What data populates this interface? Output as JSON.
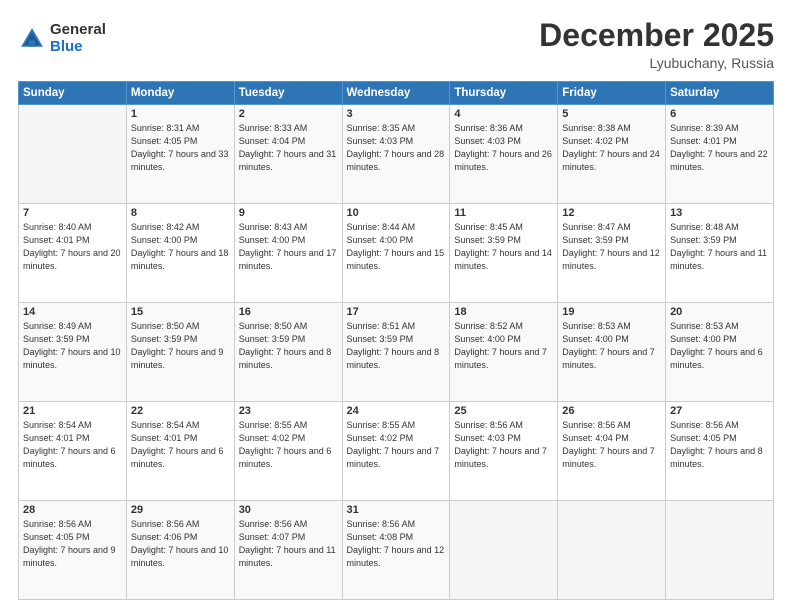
{
  "header": {
    "logo_general": "General",
    "logo_blue": "Blue",
    "month": "December 2025",
    "location": "Lyubuchany, Russia"
  },
  "days_of_week": [
    "Sunday",
    "Monday",
    "Tuesday",
    "Wednesday",
    "Thursday",
    "Friday",
    "Saturday"
  ],
  "weeks": [
    [
      {
        "num": "",
        "empty": true
      },
      {
        "num": "1",
        "sunrise": "Sunrise: 8:31 AM",
        "sunset": "Sunset: 4:05 PM",
        "daylight": "Daylight: 7 hours and 33 minutes."
      },
      {
        "num": "2",
        "sunrise": "Sunrise: 8:33 AM",
        "sunset": "Sunset: 4:04 PM",
        "daylight": "Daylight: 7 hours and 31 minutes."
      },
      {
        "num": "3",
        "sunrise": "Sunrise: 8:35 AM",
        "sunset": "Sunset: 4:03 PM",
        "daylight": "Daylight: 7 hours and 28 minutes."
      },
      {
        "num": "4",
        "sunrise": "Sunrise: 8:36 AM",
        "sunset": "Sunset: 4:03 PM",
        "daylight": "Daylight: 7 hours and 26 minutes."
      },
      {
        "num": "5",
        "sunrise": "Sunrise: 8:38 AM",
        "sunset": "Sunset: 4:02 PM",
        "daylight": "Daylight: 7 hours and 24 minutes."
      },
      {
        "num": "6",
        "sunrise": "Sunrise: 8:39 AM",
        "sunset": "Sunset: 4:01 PM",
        "daylight": "Daylight: 7 hours and 22 minutes."
      }
    ],
    [
      {
        "num": "7",
        "sunrise": "Sunrise: 8:40 AM",
        "sunset": "Sunset: 4:01 PM",
        "daylight": "Daylight: 7 hours and 20 minutes."
      },
      {
        "num": "8",
        "sunrise": "Sunrise: 8:42 AM",
        "sunset": "Sunset: 4:00 PM",
        "daylight": "Daylight: 7 hours and 18 minutes."
      },
      {
        "num": "9",
        "sunrise": "Sunrise: 8:43 AM",
        "sunset": "Sunset: 4:00 PM",
        "daylight": "Daylight: 7 hours and 17 minutes."
      },
      {
        "num": "10",
        "sunrise": "Sunrise: 8:44 AM",
        "sunset": "Sunset: 4:00 PM",
        "daylight": "Daylight: 7 hours and 15 minutes."
      },
      {
        "num": "11",
        "sunrise": "Sunrise: 8:45 AM",
        "sunset": "Sunset: 3:59 PM",
        "daylight": "Daylight: 7 hours and 14 minutes."
      },
      {
        "num": "12",
        "sunrise": "Sunrise: 8:47 AM",
        "sunset": "Sunset: 3:59 PM",
        "daylight": "Daylight: 7 hours and 12 minutes."
      },
      {
        "num": "13",
        "sunrise": "Sunrise: 8:48 AM",
        "sunset": "Sunset: 3:59 PM",
        "daylight": "Daylight: 7 hours and 11 minutes."
      }
    ],
    [
      {
        "num": "14",
        "sunrise": "Sunrise: 8:49 AM",
        "sunset": "Sunset: 3:59 PM",
        "daylight": "Daylight: 7 hours and 10 minutes."
      },
      {
        "num": "15",
        "sunrise": "Sunrise: 8:50 AM",
        "sunset": "Sunset: 3:59 PM",
        "daylight": "Daylight: 7 hours and 9 minutes."
      },
      {
        "num": "16",
        "sunrise": "Sunrise: 8:50 AM",
        "sunset": "Sunset: 3:59 PM",
        "daylight": "Daylight: 7 hours and 8 minutes."
      },
      {
        "num": "17",
        "sunrise": "Sunrise: 8:51 AM",
        "sunset": "Sunset: 3:59 PM",
        "daylight": "Daylight: 7 hours and 8 minutes."
      },
      {
        "num": "18",
        "sunrise": "Sunrise: 8:52 AM",
        "sunset": "Sunset: 4:00 PM",
        "daylight": "Daylight: 7 hours and 7 minutes."
      },
      {
        "num": "19",
        "sunrise": "Sunrise: 8:53 AM",
        "sunset": "Sunset: 4:00 PM",
        "daylight": "Daylight: 7 hours and 7 minutes."
      },
      {
        "num": "20",
        "sunrise": "Sunrise: 8:53 AM",
        "sunset": "Sunset: 4:00 PM",
        "daylight": "Daylight: 7 hours and 6 minutes."
      }
    ],
    [
      {
        "num": "21",
        "sunrise": "Sunrise: 8:54 AM",
        "sunset": "Sunset: 4:01 PM",
        "daylight": "Daylight: 7 hours and 6 minutes."
      },
      {
        "num": "22",
        "sunrise": "Sunrise: 8:54 AM",
        "sunset": "Sunset: 4:01 PM",
        "daylight": "Daylight: 7 hours and 6 minutes."
      },
      {
        "num": "23",
        "sunrise": "Sunrise: 8:55 AM",
        "sunset": "Sunset: 4:02 PM",
        "daylight": "Daylight: 7 hours and 6 minutes."
      },
      {
        "num": "24",
        "sunrise": "Sunrise: 8:55 AM",
        "sunset": "Sunset: 4:02 PM",
        "daylight": "Daylight: 7 hours and 7 minutes."
      },
      {
        "num": "25",
        "sunrise": "Sunrise: 8:56 AM",
        "sunset": "Sunset: 4:03 PM",
        "daylight": "Daylight: 7 hours and 7 minutes."
      },
      {
        "num": "26",
        "sunrise": "Sunrise: 8:56 AM",
        "sunset": "Sunset: 4:04 PM",
        "daylight": "Daylight: 7 hours and 7 minutes."
      },
      {
        "num": "27",
        "sunrise": "Sunrise: 8:56 AM",
        "sunset": "Sunset: 4:05 PM",
        "daylight": "Daylight: 7 hours and 8 minutes."
      }
    ],
    [
      {
        "num": "28",
        "sunrise": "Sunrise: 8:56 AM",
        "sunset": "Sunset: 4:05 PM",
        "daylight": "Daylight: 7 hours and 9 minutes."
      },
      {
        "num": "29",
        "sunrise": "Sunrise: 8:56 AM",
        "sunset": "Sunset: 4:06 PM",
        "daylight": "Daylight: 7 hours and 10 minutes."
      },
      {
        "num": "30",
        "sunrise": "Sunrise: 8:56 AM",
        "sunset": "Sunset: 4:07 PM",
        "daylight": "Daylight: 7 hours and 11 minutes."
      },
      {
        "num": "31",
        "sunrise": "Sunrise: 8:56 AM",
        "sunset": "Sunset: 4:08 PM",
        "daylight": "Daylight: 7 hours and 12 minutes."
      },
      {
        "num": "",
        "empty": true
      },
      {
        "num": "",
        "empty": true
      },
      {
        "num": "",
        "empty": true
      }
    ]
  ]
}
